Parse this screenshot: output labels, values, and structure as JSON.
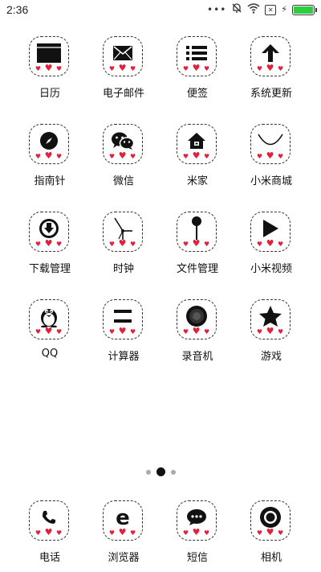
{
  "status": {
    "time": "2:36",
    "dots": "•••",
    "battery_level": 1.0
  },
  "apps": [
    {
      "label": "日历",
      "icon": "calendar-icon"
    },
    {
      "label": "电子邮件",
      "icon": "mail-icon"
    },
    {
      "label": "便签",
      "icon": "notes-icon"
    },
    {
      "label": "系统更新",
      "icon": "update-arrow-icon"
    },
    {
      "label": "指南针",
      "icon": "compass-icon"
    },
    {
      "label": "微信",
      "icon": "wechat-icon"
    },
    {
      "label": "米家",
      "icon": "home-icon"
    },
    {
      "label": "小米商城",
      "icon": "smile-icon"
    },
    {
      "label": "下载管理",
      "icon": "download-icon"
    },
    {
      "label": "时钟",
      "icon": "clock-icon"
    },
    {
      "label": "文件管理",
      "icon": "file-pin-icon"
    },
    {
      "label": "小米视频",
      "icon": "play-icon"
    },
    {
      "label": "QQ",
      "icon": "qq-penguin-icon"
    },
    {
      "label": "计算器",
      "icon": "equals-icon"
    },
    {
      "label": "录音机",
      "icon": "recorder-icon"
    },
    {
      "label": "游戏",
      "icon": "star-icon"
    }
  ],
  "dock": [
    {
      "label": "电话",
      "icon": "phone-icon"
    },
    {
      "label": "浏览器",
      "icon": "browser-icon"
    },
    {
      "label": "短信",
      "icon": "message-icon"
    },
    {
      "label": "相机",
      "icon": "camera-icon"
    }
  ],
  "pager": {
    "pages": 3,
    "current": 2
  },
  "colors": {
    "heart": "#e51e3c",
    "battery": "#2ecc40",
    "icon": "#111111"
  }
}
